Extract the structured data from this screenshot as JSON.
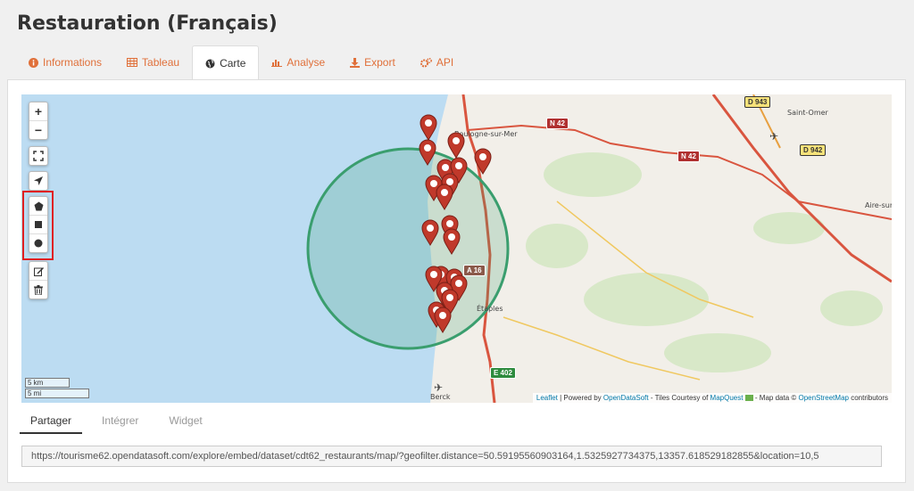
{
  "page": {
    "title": "Restauration (Français)"
  },
  "tabs": [
    {
      "label": "Informations",
      "icon": "info-icon",
      "active": false
    },
    {
      "label": "Tableau",
      "icon": "table-icon",
      "active": false
    },
    {
      "label": "Carte",
      "icon": "globe-icon",
      "active": true
    },
    {
      "label": "Analyse",
      "icon": "chart-icon",
      "active": false
    },
    {
      "label": "Export",
      "icon": "download-icon",
      "active": false
    },
    {
      "label": "API",
      "icon": "gears-icon",
      "active": false
    }
  ],
  "map": {
    "controls": {
      "zoom_in": "+",
      "zoom_out": "−"
    },
    "place_labels": {
      "boulogne": "Boulogne-sur-Mer",
      "saint_omer": "Saint-Omer",
      "aire": "Aire-sur-",
      "etaples": "Étaples",
      "berck": "Berck"
    },
    "road_badges": {
      "d943": "D 943",
      "n42a": "N 42",
      "n42b": "N 42",
      "d942": "D 942",
      "a16": "A 16",
      "e402": "E 402"
    },
    "scale": {
      "metric": "5 km",
      "imperial": "5 mi"
    },
    "attribution": {
      "leaflet": "Leaflet",
      "powered": " | Powered by ",
      "ods": "OpenDataSoft",
      "tiles": " - Tiles Courtesy of ",
      "mapquest": "MapQuest",
      "mapdata": " - Map data © ",
      "osm": "OpenStreetMap",
      "contrib": " contributors"
    },
    "colors": {
      "sea": "#bcdcf2",
      "land": "#f2efe9",
      "circle": "#3a9e6e",
      "marker": "#c0392b"
    }
  },
  "subtabs": [
    {
      "label": "Partager",
      "active": true
    },
    {
      "label": "Intégrer",
      "active": false
    },
    {
      "label": "Widget",
      "active": false
    }
  ],
  "share_url": "https://tourisme62.opendatasoft.com/explore/embed/dataset/cdt62_restaurants/map/?geofilter.distance=50.59195560903164,1.5325927734375,13357.618529182855&location=10,5"
}
